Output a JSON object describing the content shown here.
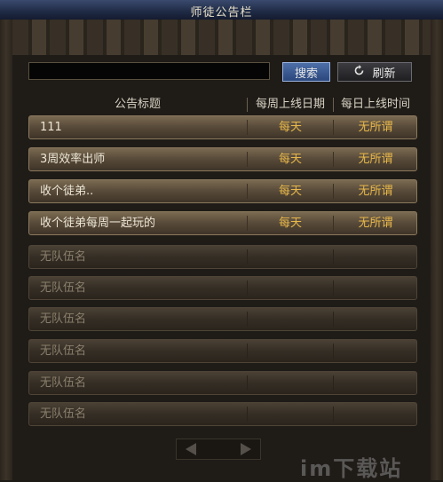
{
  "window": {
    "title": "师徒公告栏"
  },
  "search": {
    "value": "",
    "button_label": "搜索"
  },
  "refresh": {
    "label": "刷新",
    "icon": "refresh-icon"
  },
  "table": {
    "columns": [
      "公告标题",
      "每周上线日期",
      "每日上线时间"
    ],
    "rows": [
      {
        "title": "111",
        "weekly": "每天",
        "daily": "无所谓"
      },
      {
        "title": "3周效率出师",
        "weekly": "每天",
        "daily": "无所谓"
      },
      {
        "title": "收个徒弟..",
        "weekly": "每天",
        "daily": "无所谓"
      },
      {
        "title": "收个徒弟每周一起玩的",
        "weekly": "每天",
        "daily": "无所谓"
      },
      {
        "title": "无队伍名",
        "weekly": "",
        "daily": ""
      },
      {
        "title": "无队伍名",
        "weekly": "",
        "daily": ""
      },
      {
        "title": "无队伍名",
        "weekly": "",
        "daily": ""
      },
      {
        "title": "无队伍名",
        "weekly": "",
        "daily": ""
      },
      {
        "title": "无队伍名",
        "weekly": "",
        "daily": ""
      },
      {
        "title": "无队伍名",
        "weekly": "",
        "daily": ""
      }
    ]
  },
  "pager": {
    "prev_icon": "left-arrow-icon",
    "next_icon": "right-arrow-icon"
  },
  "watermark": {
    "text": "im下载站"
  },
  "colors": {
    "accent_text": "#e8b84a",
    "search_button": "#3b5b94"
  }
}
